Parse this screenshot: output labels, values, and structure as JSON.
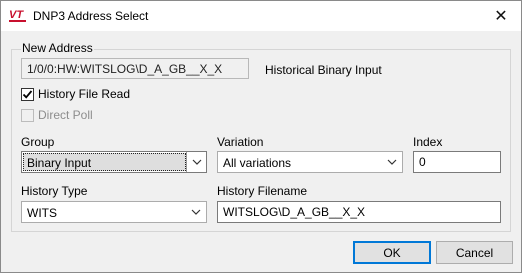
{
  "window": {
    "title": "DNP3 Address Select",
    "app_icon": "vt-logo-icon",
    "close_glyph": "✕"
  },
  "address": {
    "group_label": "New Address",
    "value": "1/0/0:HW:WITSLOG\\D_A_GB__X_X",
    "type_label": "Historical Binary Input"
  },
  "options": {
    "history_file_read": {
      "label": "History File Read",
      "checked": true
    },
    "direct_poll": {
      "label": "Direct Poll",
      "checked": false,
      "disabled": true
    }
  },
  "group_field": {
    "label": "Group",
    "value": "Binary Input"
  },
  "variation_field": {
    "label": "Variation",
    "value": "All variations"
  },
  "index_field": {
    "label": "Index",
    "value": "0"
  },
  "history_type_field": {
    "label": "History Type",
    "value": "WITS"
  },
  "history_filename_field": {
    "label": "History Filename",
    "value": "WITSLOG\\D_A_GB__X_X"
  },
  "buttons": {
    "ok": "OK",
    "cancel": "Cancel"
  },
  "colors": {
    "accent": "#0078d7",
    "logo_red": "#c8102e",
    "window_bg": "#f0f0f0"
  }
}
